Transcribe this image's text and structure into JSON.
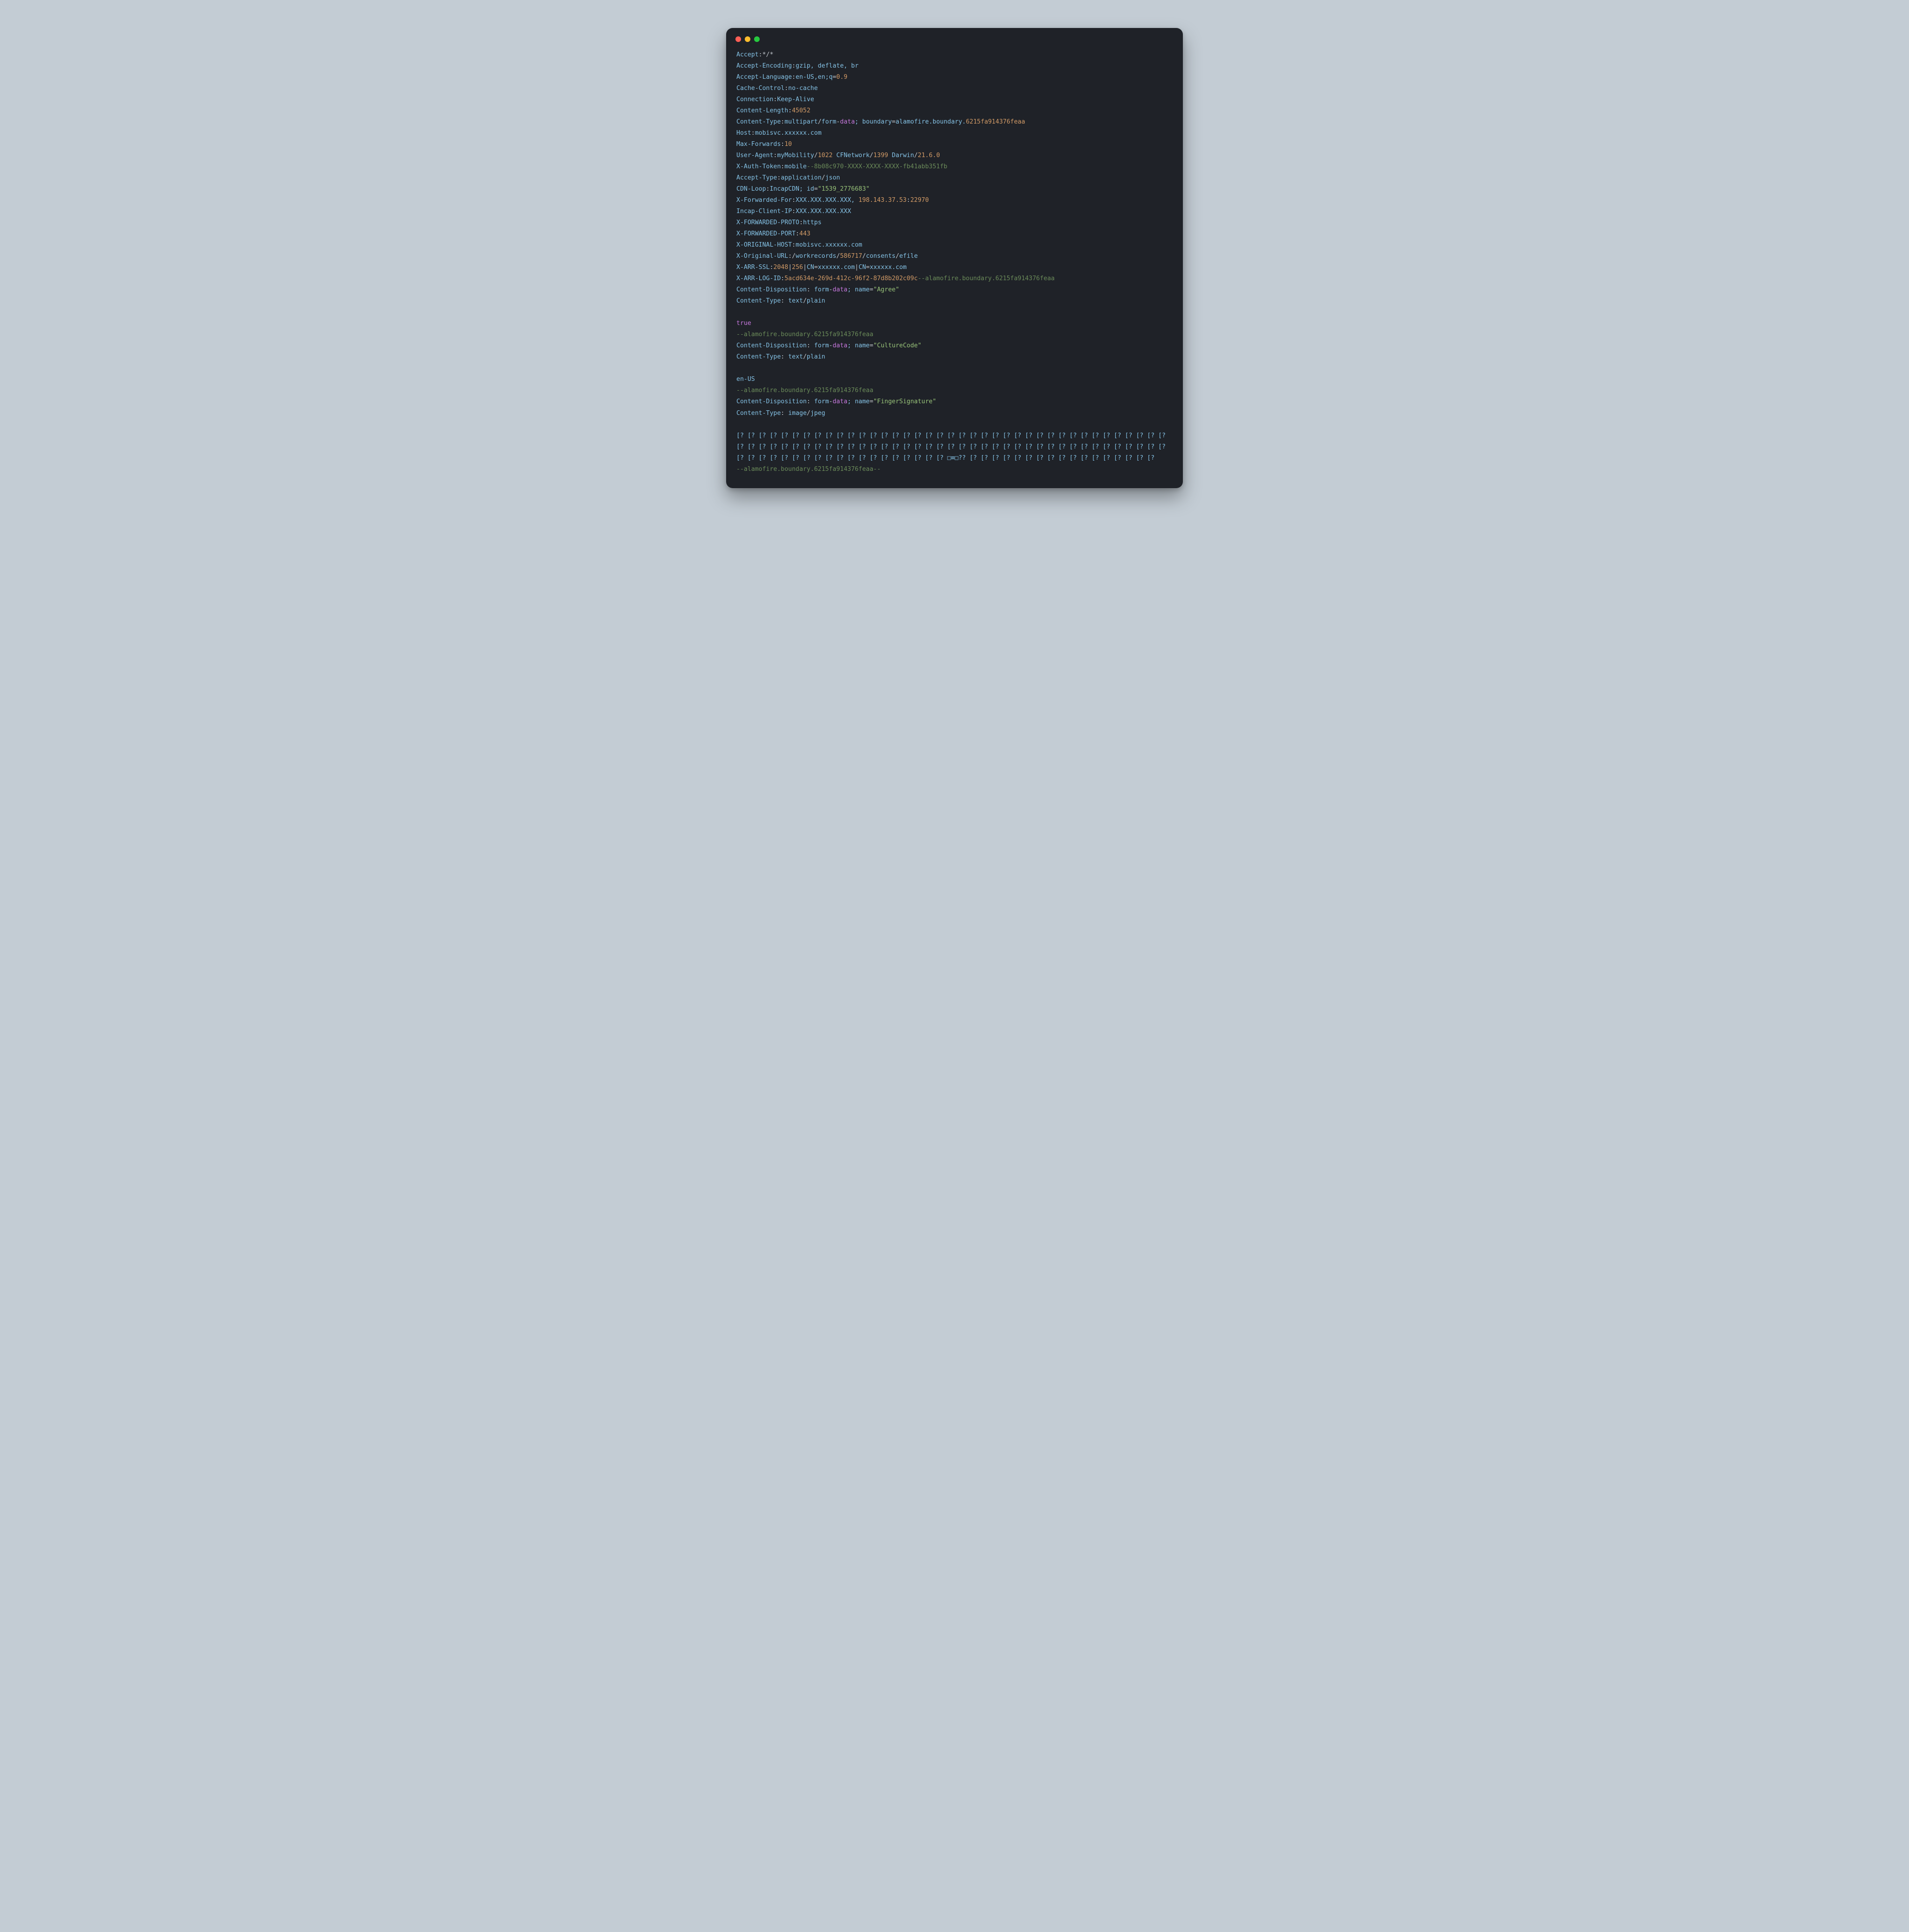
{
  "headers": {
    "accept_k": "Accept",
    "accept_v": "*/*",
    "accenc_k": "Accept-Encoding",
    "accenc_v": "gzip, deflate, br",
    "acclang_k": "Accept-Language",
    "acclang_v1": "en-US,en;q",
    "acclang_eq": "=",
    "acclang_v2": "0.9",
    "cache_k": "Cache-Control",
    "cache_v": "no-cache",
    "conn_k": "Connection",
    "conn_v": "Keep-Alive",
    "clen_k": "Content-Length",
    "clen_v": "45052",
    "ctype_k": "Content-Type",
    "ctype_v1": "multipart",
    "ctype_v2": "form",
    "ctype_v3": "data",
    "ctype_v4": "; boundary",
    "ctype_v5": "alamofire.boundary.",
    "ctype_v6": "6215fa914376feaa",
    "host_k": "Host",
    "host_v": "mobisvc.xxxxxx.com",
    "maxfwd_k": "Max-Forwards",
    "maxfwd_v": "10",
    "ua_k": "User-Agent",
    "ua_v1": "myMobility",
    "ua_v2": "1022",
    "ua_v3": " CFNetwork",
    "ua_v4": "1399",
    "ua_v5": " Darwin",
    "ua_v6": "21.6.0",
    "xauth_k": "X-Auth-Token",
    "xauth_v1": "mobile",
    "xauth_v2": "--8b08c970-XXXX-XXXX-XXXX-fb41abb351fb",
    "acctype_k": "Accept-Type",
    "acctype_v1": "application",
    "acctype_v2": "json",
    "cdn_k": "CDN-Loop",
    "cdn_v1": "IncapCDN; id",
    "cdn_v2": "\"1539_2776683\"",
    "xff_k": "X-Forwarded-For",
    "xff_v1": "XXX.XXX.XXX.XXX, ",
    "xff_v2": "198.143.37.53",
    "xff_v3": "22970",
    "incap_k": "Incap-Client-IP",
    "incap_v": "XXX.XXX.XXX.XXX",
    "xproto_k": "X-FORWARDED-PROTO",
    "xproto_v": "https",
    "xport_k": "X-FORWARDED-PORT",
    "xport_v": "443",
    "xohost_k": "X-ORIGINAL-HOST",
    "xohost_v": "mobisvc.xxxxxx.com",
    "xourl_k": "X-Original-URL",
    "xourl_v1": "workrecords",
    "xourl_v2": "586717",
    "xourl_v3": "consents",
    "xourl_v4": "efile",
    "xarrssl_k": "X-ARR-SSL",
    "xarrssl_v1": "2048",
    "xarrssl_v2": "256",
    "xarrssl_v3": "CN",
    "xarrssl_v4": "xxxxxx.com",
    "xarrlog_k": "X-ARR-LOG-ID",
    "xarrlog_v1": "5acd634e-269d-412c-96f2-87d8b202c09c",
    "xarrlog_v2": "--alamofire.boundary.6215fa914376feaa"
  },
  "parts": {
    "cd": "Content-Disposition",
    "ct": "Content-Type",
    "fd": " form",
    "data": "data",
    "name": "; name",
    "tp": "text",
    "plain": "plain",
    "img": "image",
    "jpeg": "jpeg",
    "agree": "\"Agree\"",
    "culture": "\"CultureCode\"",
    "finger": "\"FingerSignature\"",
    "true": "true",
    "enus": "en-US",
    "boundary": "--alamofire.boundary.6215fa914376feaa",
    "boundary_end": "--alamofire.boundary.6215fa914376feaa--",
    "bin1": "[? [? [? [? [? [? [? [? [? [? [? [? [? [? [? [? [? [? [? [? [? [? [? [? [? [? [? [? [? [? [? [? [? [? [? [? [? [? [? [? [? [? [? [? [? [? [? [? [? [? [? [? [? [? [? [? [? [? [? [? [? [? [? [? [? [? [? [? [? [? [? [? [? [? [? [? [? [? [? [? [? [? [? [? [? [? [? [? [? [? [? [? [? [? [? [? [? □≡□?? [? [? [? [? [? [? [? [? [? [? [? [? [? [? [? [? [?"
  },
  "punc": {
    "colon": ":",
    "slash": "/",
    "dash": "-",
    "eq": "=",
    "pipe": "|",
    "dot6": "6"
  }
}
